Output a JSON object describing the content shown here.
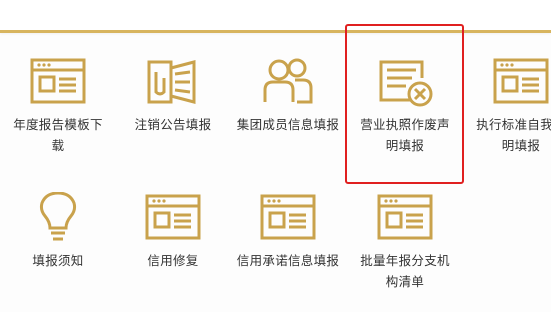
{
  "colors": {
    "accent": "#d8b55f",
    "icon": "#c9a24c",
    "highlight": "#e02020"
  },
  "tiles": [
    {
      "label": "年度报告模板下载",
      "icon": "form-window-icon"
    },
    {
      "label": "注销公告填报",
      "icon": "megaphone-icon"
    },
    {
      "label": "集团成员信息填报",
      "icon": "group-members-icon"
    },
    {
      "label": "营业执照作废声明填报",
      "icon": "document-cancel-icon",
      "highlighted": true
    },
    {
      "label": "执行标准自我声明填报",
      "icon": "form-window-icon"
    },
    {
      "label": "填报须知",
      "icon": "lightbulb-icon"
    },
    {
      "label": "信用修复",
      "icon": "form-window-icon"
    },
    {
      "label": "信用承诺信息填报",
      "icon": "form-window-icon"
    },
    {
      "label": "批量年报分支机构清单",
      "icon": "form-window-icon"
    }
  ]
}
